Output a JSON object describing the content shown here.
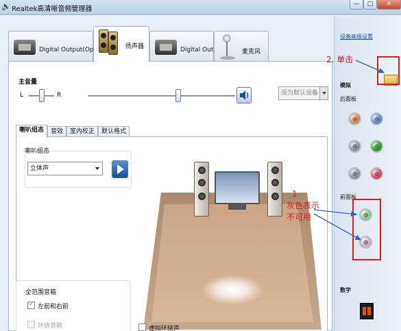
{
  "window": {
    "title": "Realtek高清晰音频管理器",
    "min_glyph": "—",
    "max_glyph": "□",
    "close_glyph": "✕"
  },
  "device_tabs": [
    {
      "label": "Digital Output(Optical)",
      "icon": "optical-output-icon"
    },
    {
      "label": "扬声器",
      "icon": "speakers-icon"
    },
    {
      "label": "Digital Output",
      "icon": "digital-output-icon"
    },
    {
      "label": "麦克风",
      "icon": "microphone-icon"
    }
  ],
  "volume": {
    "title": "主音量",
    "left": "L",
    "right": "R",
    "balance": 0.5,
    "level": 0.62,
    "default_device": "设为默认设备"
  },
  "sub_tabs": [
    "喇叭组态",
    "音效",
    "室内校正",
    "默认格式"
  ],
  "speaker_config": {
    "group_label": "喇叭组态",
    "selected": "立体声"
  },
  "full_range": {
    "title": "全范围音箱",
    "front": {
      "label": "左前和右前",
      "checked": true
    },
    "surround": {
      "label": "环绕音箱",
      "checked": false
    }
  },
  "virtual_surround": {
    "label": "虚拟环绕声",
    "checked": false
  },
  "side_panel": {
    "advanced_link": "设备高级设置",
    "analog": "模拟",
    "rear": "后面板",
    "front": "前面板",
    "digital": "数字",
    "rear_jacks": [
      {
        "color": "#e0834a"
      },
      {
        "color": "#5a88cf"
      },
      {
        "color": "#8a8f96"
      },
      {
        "color": "#1fa31a"
      },
      {
        "color": "#8d9096"
      },
      {
        "color": "#e23c56"
      }
    ],
    "front_jacks": [
      {
        "color": "#8fbf8f"
      },
      {
        "color": "#d9a9c4"
      }
    ]
  },
  "annotations": {
    "step2": "2. 单击",
    "step1_num": "1",
    "step1_line1": "灰色表示",
    "step1_line2": "不可用"
  },
  "colors": {
    "annotation": "#e11b1b",
    "link": "#1f55b0"
  }
}
